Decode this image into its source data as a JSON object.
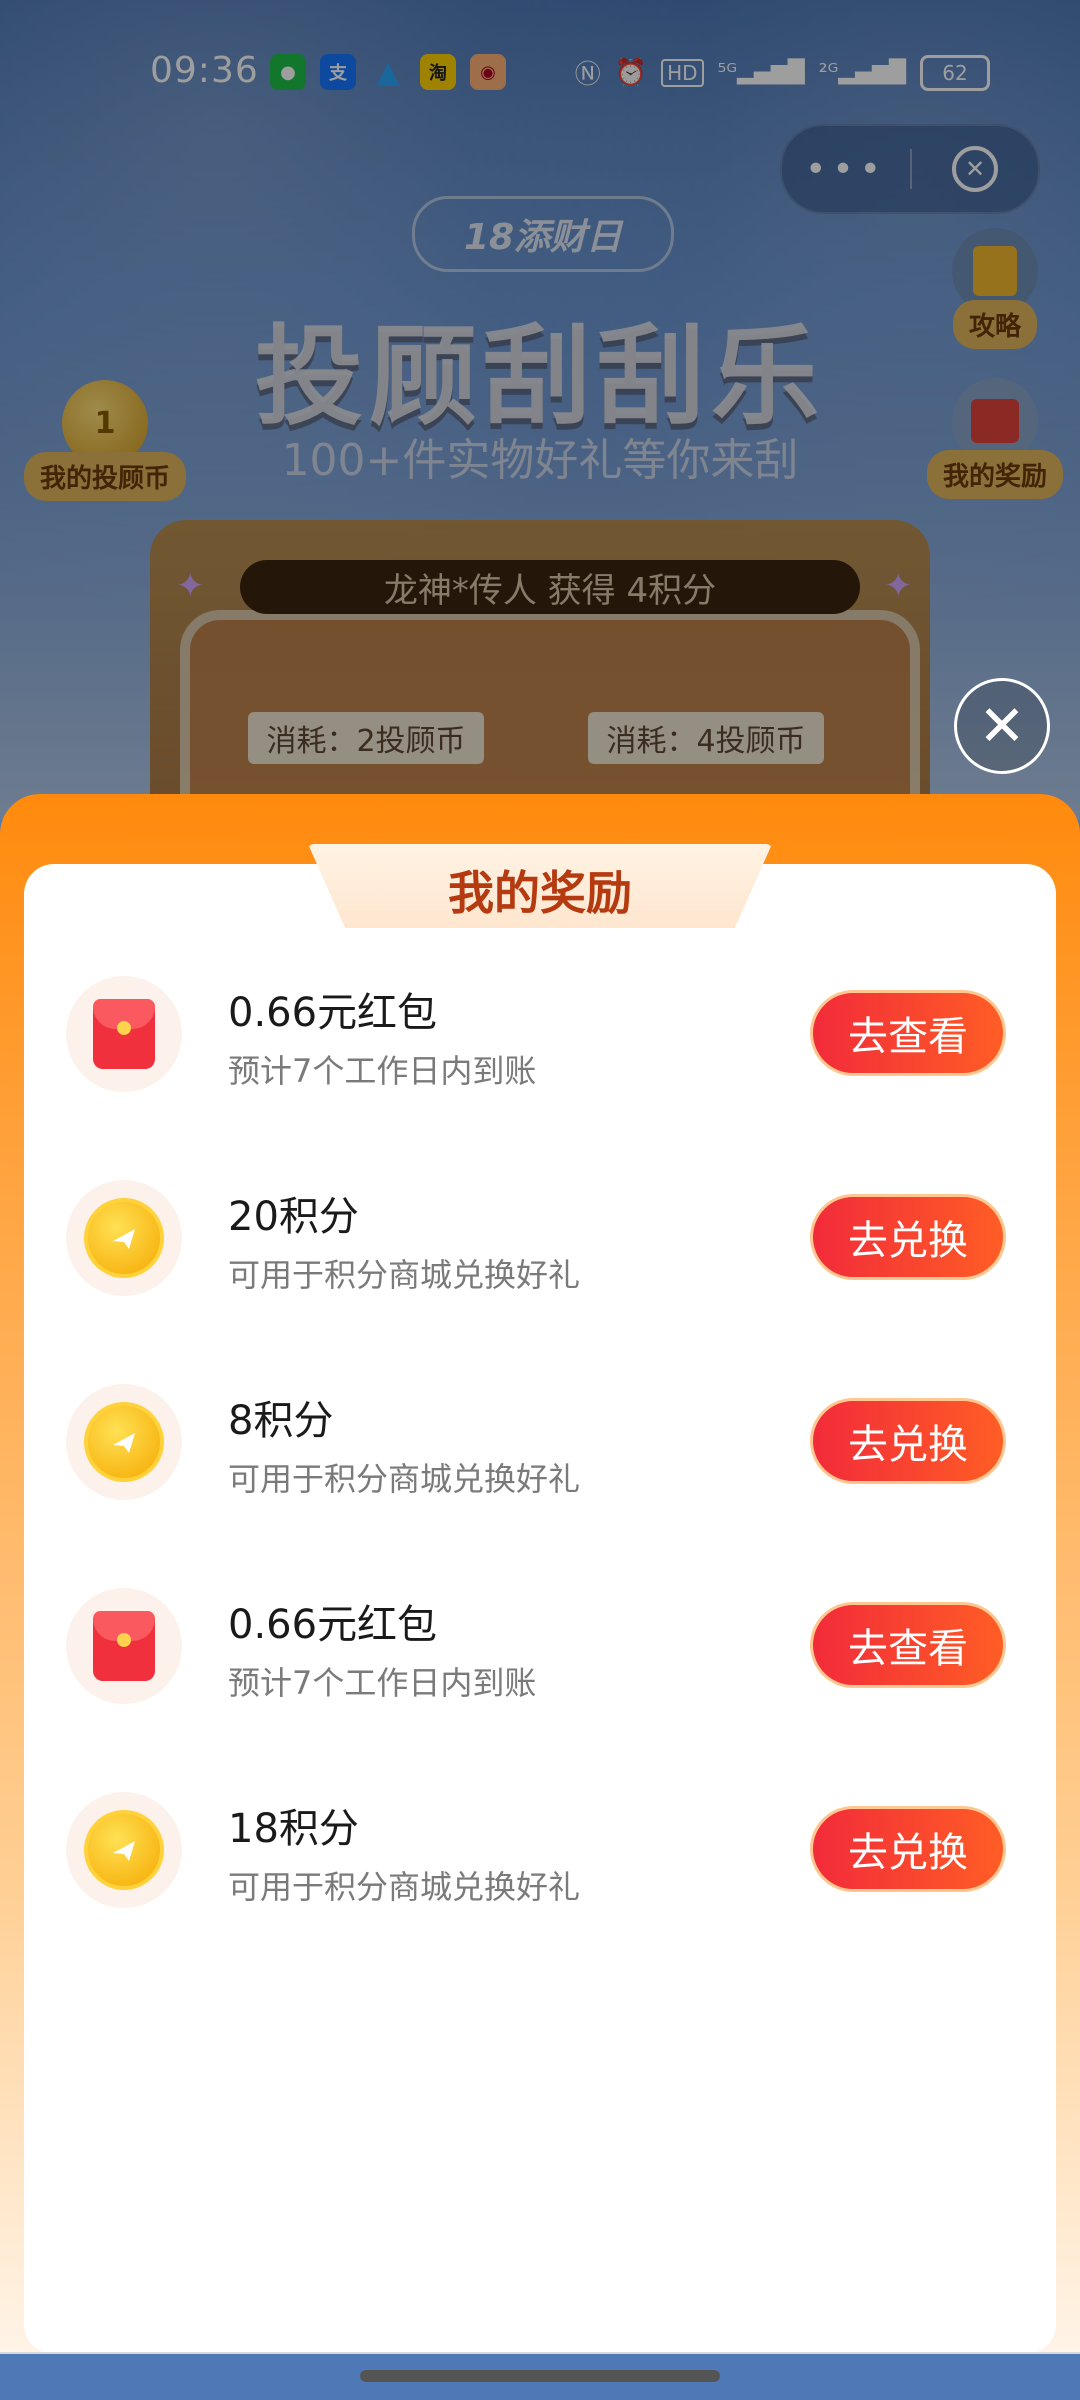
{
  "status_bar": {
    "time": "09:36",
    "app_icons": [
      "wechat-icon",
      "alipay-icon",
      "qq-icon",
      "taobao-icon",
      "app-icon"
    ],
    "battery": "62"
  },
  "capsule": {
    "more": "•••"
  },
  "banner": {
    "tag": "18添财日",
    "title": "投顾刮刮乐",
    "subtitle": "100+件实物好礼等你来刮",
    "left_badge_value": "1",
    "left_badge_label": "我的投顾币",
    "right_badge_top_label": "攻略",
    "right_badge_bottom_label": "我的奖励",
    "ticker": "龙神*传人 获得 4积分",
    "cost_left": "消耗：2投顾币",
    "cost_right": "消耗：4投顾币"
  },
  "sheet": {
    "title": "我的奖励",
    "items": [
      {
        "icon": "red-envelope-icon",
        "title": "0.66元红包",
        "subtitle": "预计7个工作日内到账",
        "button": "去查看"
      },
      {
        "icon": "points-coin-icon",
        "title": "20积分",
        "subtitle": "可用于积分商城兑换好礼",
        "button": "去兑换"
      },
      {
        "icon": "points-coin-icon",
        "title": "8积分",
        "subtitle": "可用于积分商城兑换好礼",
        "button": "去兑换"
      },
      {
        "icon": "red-envelope-icon",
        "title": "0.66元红包",
        "subtitle": "预计7个工作日内到账",
        "button": "去查看"
      },
      {
        "icon": "points-coin-icon",
        "title": "18积分",
        "subtitle": "可用于积分商城兑换好礼",
        "button": "去兑换"
      }
    ]
  },
  "colors": {
    "accent": "#ff8a0d",
    "button_start": "#f22b3a",
    "button_end": "#ff5d25",
    "title": "#b53a10"
  }
}
